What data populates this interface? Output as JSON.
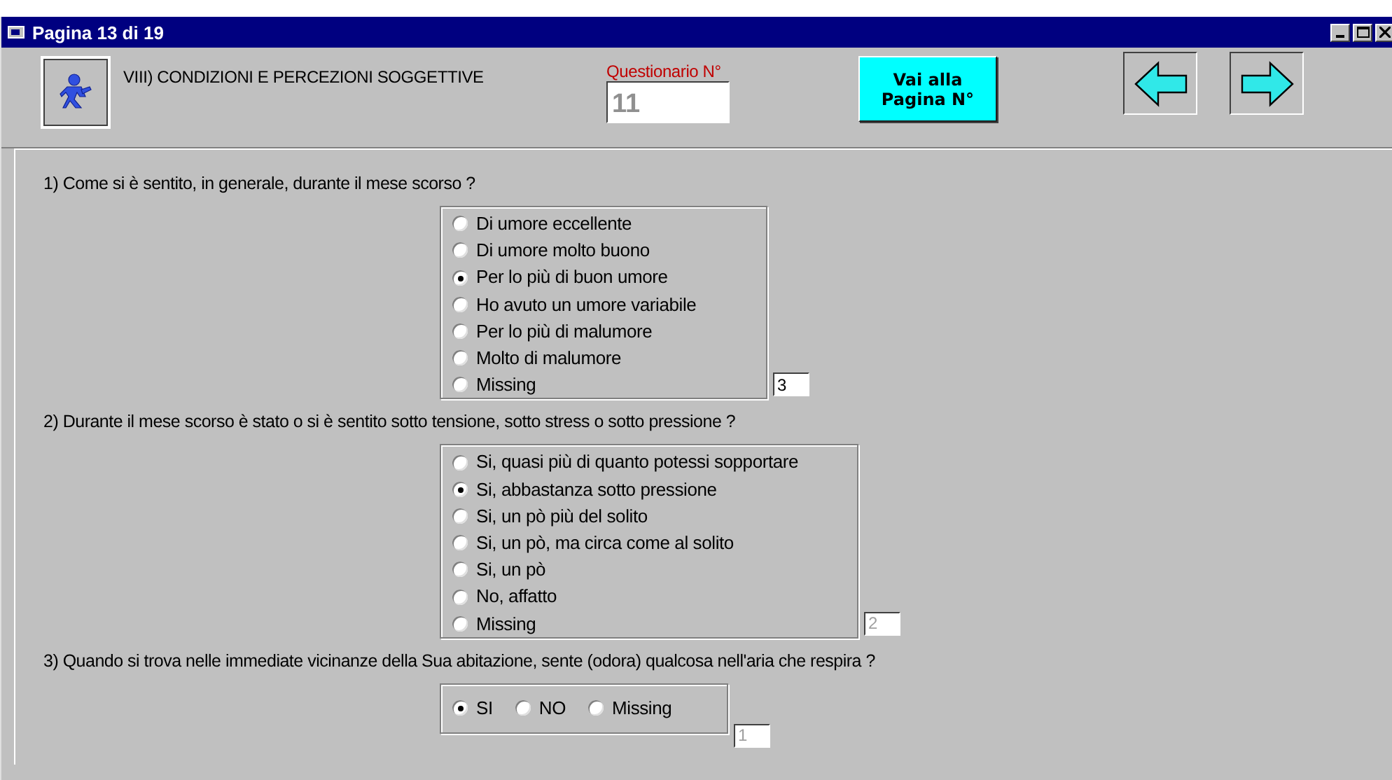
{
  "window": {
    "title": "Pagina 13 di 19"
  },
  "header": {
    "section_title": "VIII) CONDIZIONI E PERCEZIONI SOGGETTIVE",
    "questionnaire_label": "Questionario N°",
    "questionnaire_number": "11",
    "goto_button": "Vai alla Pagina N°"
  },
  "questions": [
    {
      "text": "1) Come si è sentito, in generale, durante il mese scorso ?",
      "kind": "vertical",
      "options": [
        {
          "label": "Di umore eccellente",
          "selected": false
        },
        {
          "label": "Di umore molto buono",
          "selected": false
        },
        {
          "label": "Per lo più di buon umore",
          "selected": true
        },
        {
          "label": "Ho avuto un umore variabile",
          "selected": false
        },
        {
          "label": "Per lo più di malumore",
          "selected": false
        },
        {
          "label": "Molto di malumore",
          "selected": false
        },
        {
          "label": "Missing",
          "selected": false
        }
      ],
      "code": {
        "value": "3",
        "disabled": false
      }
    },
    {
      "text": "2) Durante il mese scorso è stato o si è sentito sotto tensione, sotto stress o sotto pressione ?",
      "kind": "vertical",
      "options": [
        {
          "label": "Si, quasi più di quanto potessi sopportare",
          "selected": false
        },
        {
          "label": "Si, abbastanza sotto pressione",
          "selected": true
        },
        {
          "label": "Si, un pò più del solito",
          "selected": false
        },
        {
          "label": "Si, un pò, ma circa come al solito",
          "selected": false
        },
        {
          "label": "Si, un pò",
          "selected": false
        },
        {
          "label": "No, affatto",
          "selected": false
        },
        {
          "label": "Missing",
          "selected": false
        }
      ],
      "code": {
        "value": "2",
        "disabled": true
      }
    },
    {
      "text": "3) Quando si trova nelle immediate vicinanze della Sua abitazione, sente (odora) qualcosa nell'aria che respira ?",
      "kind": "horizontal",
      "options": [
        {
          "label": "SI",
          "selected": true
        },
        {
          "label": "NO",
          "selected": false
        },
        {
          "label": "Missing",
          "selected": false
        }
      ],
      "code": {
        "value": "1",
        "disabled": true
      }
    }
  ]
}
